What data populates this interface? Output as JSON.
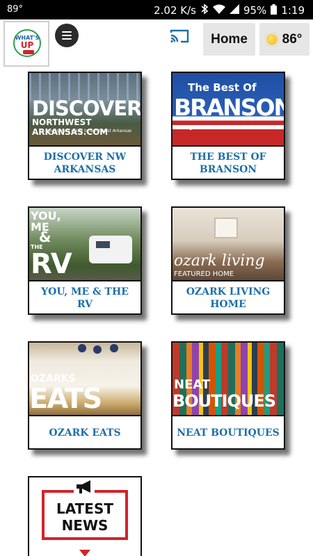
{
  "status_bar": {
    "temperature": "89°",
    "speed": "2.02 K/s",
    "battery": "95%",
    "time": "1:19"
  },
  "header": {
    "logo_line1": "WHAT'S",
    "logo_line2": "UP",
    "home_label": "Home",
    "weather_temp": "86°"
  },
  "tiles": [
    {
      "label": "DISCOVER NW ARKANSAS",
      "art_line1": "DISCOVER",
      "art_line2": "NORTHWEST ARKANSAS.COM",
      "art_line3": "A newcomers guide to Northwest Arkansas"
    },
    {
      "label": "THE BEST OF BRANSON",
      "art_line1": "The Best Of",
      "art_line2": "BRANSON"
    },
    {
      "label": "YOU, ME & THE RV",
      "art_line1": "YOU,",
      "art_line2": "ME",
      "art_line3": "&",
      "art_line4": "THE",
      "art_line5": "RV"
    },
    {
      "label": "OZARK LIVING HOME",
      "art_line1": "ozark living",
      "art_line2": "FEATURED HOME"
    },
    {
      "label": "OZARK EATS",
      "art_line1": "OZARKS",
      "art_line2": "EATS"
    },
    {
      "label": "NEAT BOUTIQUES",
      "art_line1": "NEAT",
      "art_line2": "BOUTIQUES"
    }
  ],
  "latest_news": {
    "line1": "LATEST",
    "line2": "NEWS"
  }
}
